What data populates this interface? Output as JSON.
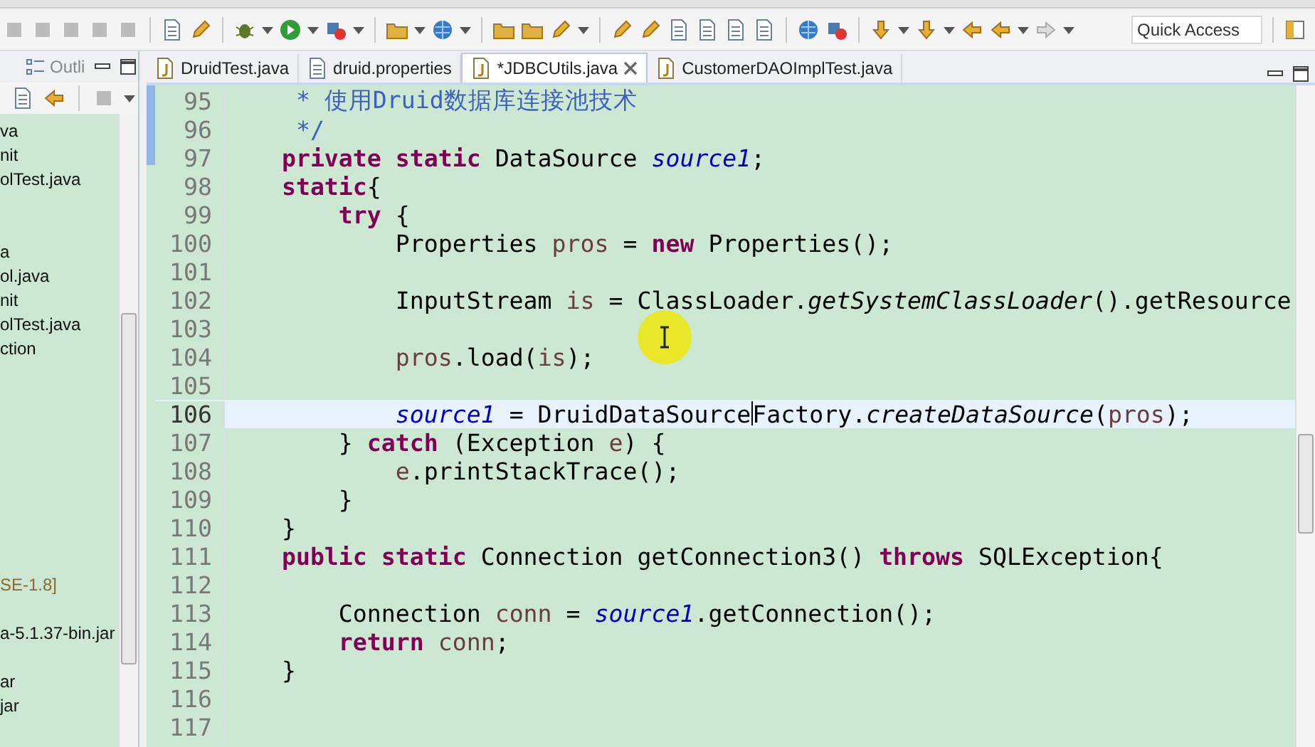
{
  "toolbar": {
    "quick_access": {
      "placeholder": "Quick Access"
    }
  },
  "left_panel": {
    "tab": {
      "label": "Outli",
      "selected": false
    },
    "groups": [
      [
        "va",
        "nit",
        "olTest.java"
      ],
      [
        "a",
        "ol.java",
        "nit",
        "olTest.java",
        "ction"
      ],
      [
        {
          "text": "SE-1.8]",
          "kind": "library"
        }
      ],
      [
        "a-5.1.37-bin.jar"
      ],
      [
        "ar",
        "jar"
      ]
    ]
  },
  "editor": {
    "tabs": [
      {
        "label": "DruidTest.java",
        "kind": "java",
        "selected": false
      },
      {
        "label": "druid.properties",
        "kind": "properties",
        "selected": false
      },
      {
        "label": "*JDBCUtils.java",
        "kind": "java",
        "selected": true
      },
      {
        "label": "CustomerDAOImplTest.java",
        "kind": "java",
        "selected": false
      }
    ],
    "lines": [
      {
        "number": "95",
        "current": false,
        "tokens": [
          {
            "text": "     * 使用Druid数据库连接池技术",
            "kind": "comment"
          }
        ]
      },
      {
        "number": "96",
        "current": false,
        "tokens": [
          {
            "text": "     */",
            "kind": "comment"
          }
        ]
      },
      {
        "number": "97",
        "current": false,
        "tokens": [
          {
            "text": "    private static",
            "kind": "keyword"
          },
          {
            "text": " DataSource ",
            "kind": "plain"
          },
          {
            "text": "source1",
            "kind": "field"
          },
          {
            "text": ";",
            "kind": "plain"
          }
        ]
      },
      {
        "number": "98",
        "current": false,
        "tokens": [
          {
            "text": "    static",
            "kind": "keyword"
          },
          {
            "text": "{",
            "kind": "plain"
          }
        ]
      },
      {
        "number": "99",
        "current": false,
        "tokens": [
          {
            "text": "        try",
            "kind": "keyword"
          },
          {
            "text": " {",
            "kind": "plain"
          }
        ]
      },
      {
        "number": "100",
        "current": false,
        "tokens": [
          {
            "text": "            Properties ",
            "kind": "plain"
          },
          {
            "text": "pros",
            "kind": "local"
          },
          {
            "text": " = ",
            "kind": "plain"
          },
          {
            "text": "new",
            "kind": "keyword"
          },
          {
            "text": " Properties();",
            "kind": "plain"
          }
        ]
      },
      {
        "number": "101",
        "current": false
      },
      {
        "number": "102",
        "current": false,
        "tokens": [
          {
            "text": "            InputStream ",
            "kind": "plain"
          },
          {
            "text": "is",
            "kind": "local"
          },
          {
            "text": " = ClassLoader.",
            "kind": "plain"
          },
          {
            "text": "getSystemClassLoader",
            "kind": "static"
          },
          {
            "text": "().getResource",
            "kind": "plain"
          }
        ]
      },
      {
        "number": "103",
        "current": false
      },
      {
        "number": "104",
        "current": false,
        "tokens": [
          {
            "text": "            pros",
            "kind": "local"
          },
          {
            "text": ".load(",
            "kind": "plain"
          },
          {
            "text": "is",
            "kind": "local"
          },
          {
            "text": ");",
            "kind": "plain"
          }
        ]
      },
      {
        "number": "105",
        "current": false
      },
      {
        "number": "106",
        "current": true,
        "tokens": [
          {
            "text": "            source1",
            "kind": "field"
          },
          {
            "text": " = DruidDataSource",
            "kind": "plain",
            "caret": true
          },
          {
            "text": "Factory.",
            "kind": "plain"
          },
          {
            "text": "createDataSource",
            "kind": "static"
          },
          {
            "text": "(",
            "kind": "plain"
          },
          {
            "text": "pros",
            "kind": "local"
          },
          {
            "text": ");",
            "kind": "plain"
          }
        ]
      },
      {
        "number": "107",
        "current": false,
        "tokens": [
          {
            "text": "        } ",
            "kind": "plain"
          },
          {
            "text": "catch",
            "kind": "keyword"
          },
          {
            "text": " (Exception ",
            "kind": "plain"
          },
          {
            "text": "e",
            "kind": "local"
          },
          {
            "text": ") {",
            "kind": "plain"
          }
        ]
      },
      {
        "number": "108",
        "current": false,
        "tokens": [
          {
            "text": "            e",
            "kind": "local"
          },
          {
            "text": ".printStackTrace();",
            "kind": "plain"
          }
        ]
      },
      {
        "number": "109",
        "current": false,
        "tokens": [
          {
            "text": "        }",
            "kind": "plain"
          }
        ]
      },
      {
        "number": "110",
        "current": false,
        "tokens": [
          {
            "text": "    }",
            "kind": "plain"
          }
        ]
      },
      {
        "number": "111",
        "current": false,
        "tokens": [
          {
            "text": "    public static",
            "kind": "keyword"
          },
          {
            "text": " Connection getConnection3() ",
            "kind": "plain"
          },
          {
            "text": "throws",
            "kind": "keyword"
          },
          {
            "text": " SQLException{",
            "kind": "plain"
          }
        ]
      },
      {
        "number": "112",
        "current": false
      },
      {
        "number": "113",
        "current": false,
        "tokens": [
          {
            "text": "        Connection ",
            "kind": "plain"
          },
          {
            "text": "conn",
            "kind": "local"
          },
          {
            "text": " = ",
            "kind": "plain"
          },
          {
            "text": "source1",
            "kind": "field"
          },
          {
            "text": ".getConnection();",
            "kind": "plain"
          }
        ]
      },
      {
        "number": "114",
        "current": false,
        "tokens": [
          {
            "text": "        return",
            "kind": "keyword"
          },
          {
            "text": " conn",
            "kind": "local"
          },
          {
            "text": ";",
            "kind": "plain"
          }
        ]
      },
      {
        "number": "115",
        "current": false,
        "tokens": [
          {
            "text": "    }",
            "kind": "plain"
          }
        ]
      },
      {
        "number": "116",
        "current": false
      },
      {
        "number": "117",
        "current": false
      }
    ]
  }
}
